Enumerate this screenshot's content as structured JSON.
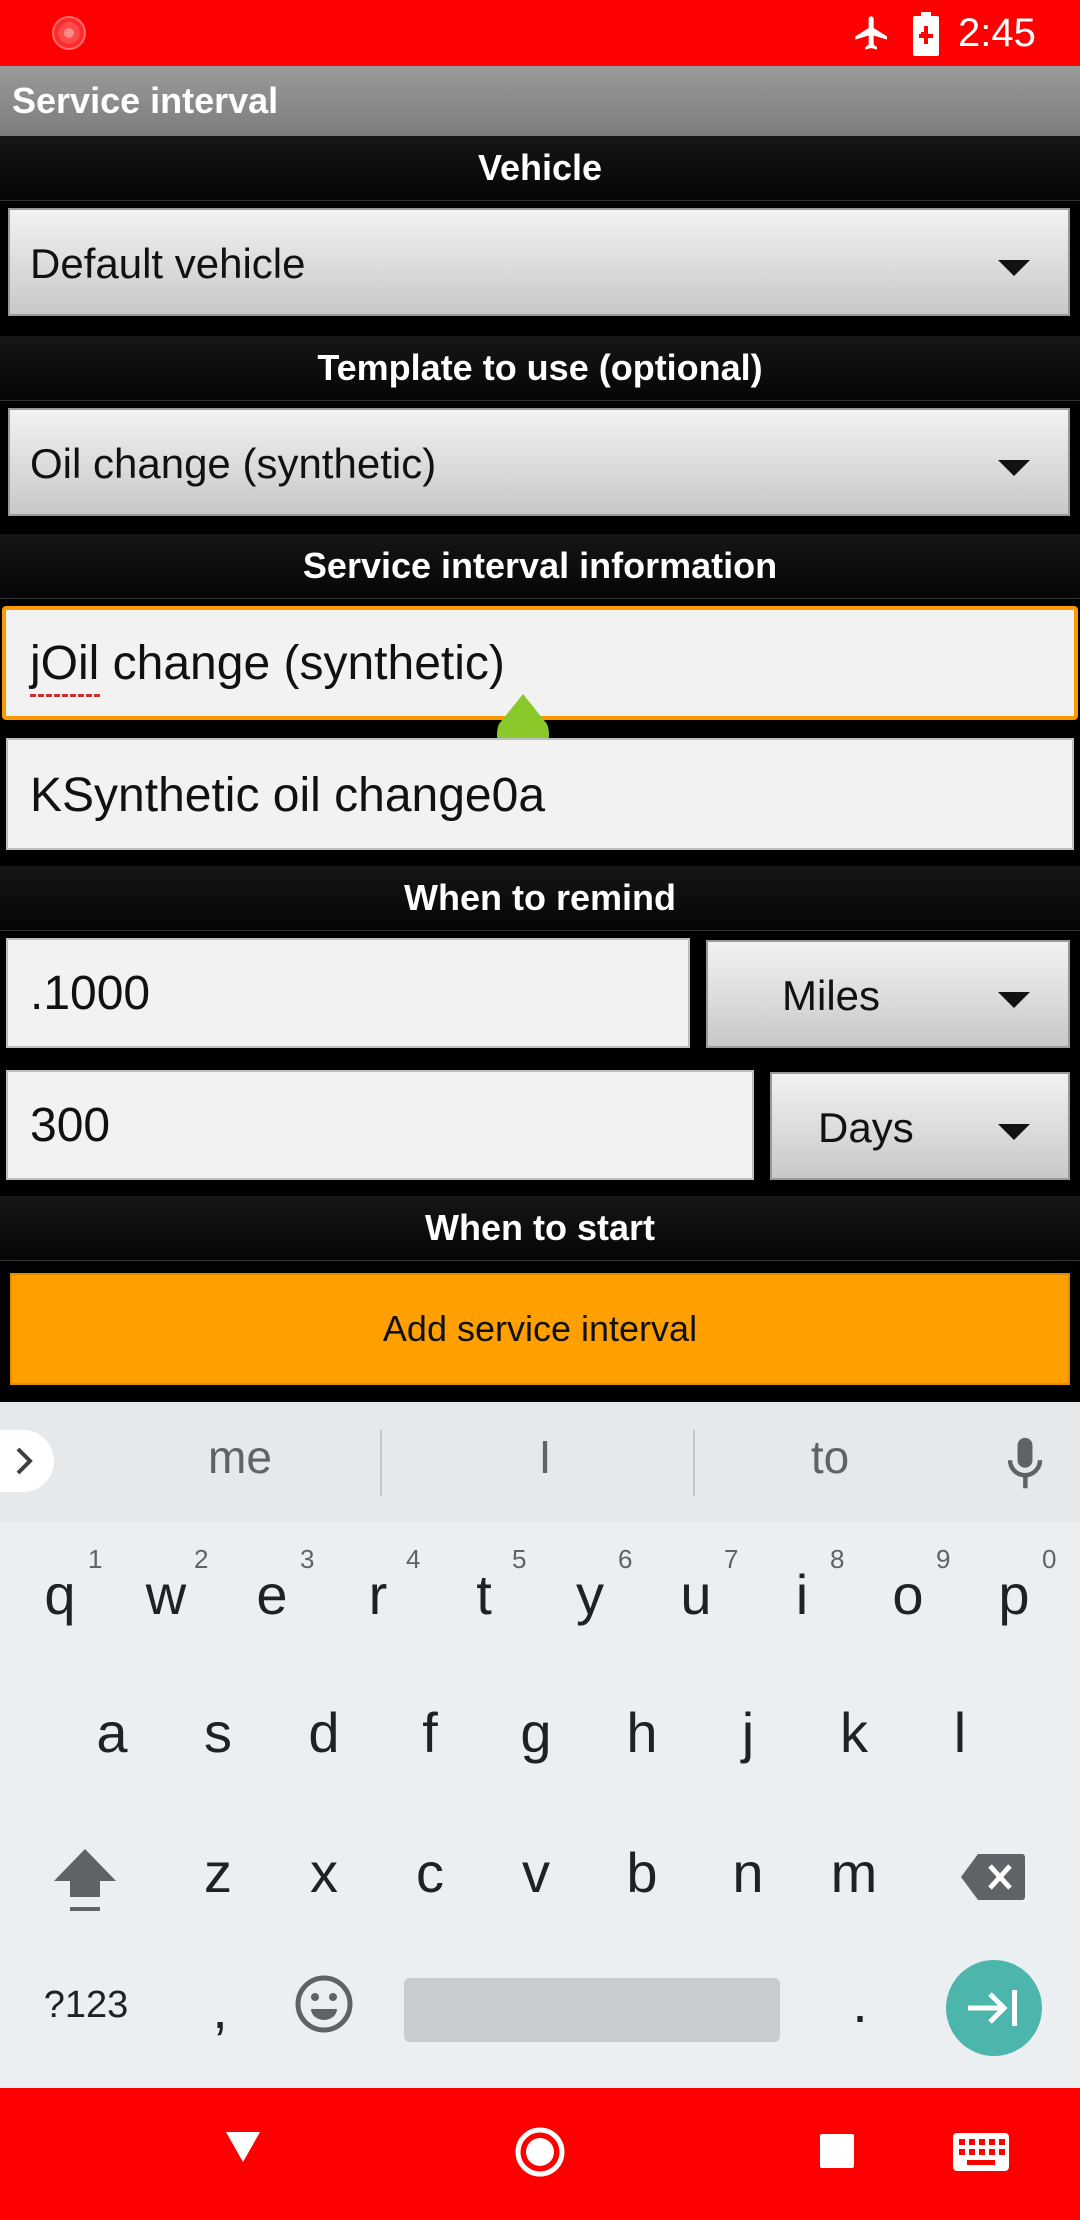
{
  "status_bar": {
    "time": "2:45",
    "icons": [
      "recording-icon",
      "airplane-mode-icon",
      "battery-charging-icon"
    ]
  },
  "app": {
    "title": "Service interval"
  },
  "sections": {
    "vehicle": "Vehicle",
    "template": "Template to use (optional)",
    "info": "Service interval information",
    "remind": "When to remind",
    "start": "When to start"
  },
  "vehicle_select": {
    "value": "Default vehicle"
  },
  "template_select": {
    "value": "Oil change (synthetic)"
  },
  "name_field": {
    "value": "jOil change (synthetic)"
  },
  "description_field": {
    "value": "KSynthetic oil change0a"
  },
  "distance_field": {
    "value": ".1000"
  },
  "distance_unit": {
    "value": "Miles"
  },
  "time_field": {
    "value": "300"
  },
  "time_unit": {
    "value": "Days"
  },
  "add_button": {
    "label": "Add service interval"
  },
  "keyboard": {
    "suggestions": [
      "me",
      "I",
      "to"
    ],
    "row1": [
      {
        "k": "q",
        "h": "1"
      },
      {
        "k": "w",
        "h": "2"
      },
      {
        "k": "e",
        "h": "3"
      },
      {
        "k": "r",
        "h": "4"
      },
      {
        "k": "t",
        "h": "5"
      },
      {
        "k": "y",
        "h": "6"
      },
      {
        "k": "u",
        "h": "7"
      },
      {
        "k": "i",
        "h": "8"
      },
      {
        "k": "o",
        "h": "9"
      },
      {
        "k": "p",
        "h": "0"
      }
    ],
    "row2": [
      "a",
      "s",
      "d",
      "f",
      "g",
      "h",
      "j",
      "k",
      "l"
    ],
    "row3": [
      "z",
      "x",
      "c",
      "v",
      "b",
      "n",
      "m"
    ],
    "symbols_label": "?123",
    "comma": ",",
    "period": "."
  },
  "colors": {
    "status_bar": "#ff0000",
    "accent": "#ffa000",
    "focus_border": "#ff9800",
    "enter_key": "#4db6ac"
  }
}
